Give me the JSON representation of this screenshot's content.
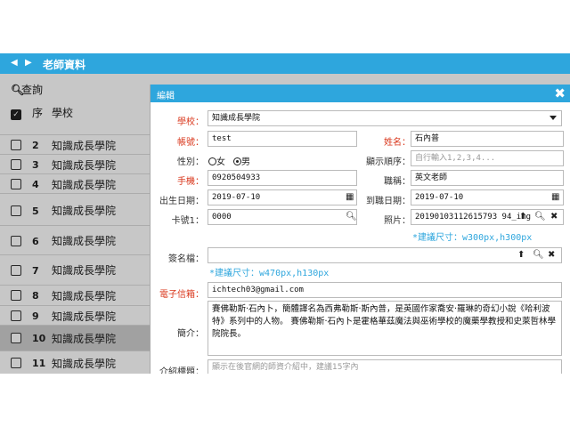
{
  "topbar": {
    "title": "老師資料",
    "prev_icon": "chevron-left-icon",
    "next_icon": "chevron-right-icon"
  },
  "list": {
    "search_label": "查詢",
    "header": {
      "seq": "序",
      "school": "學校"
    },
    "rows": [
      {
        "num": "2",
        "school": "知識成長學院"
      },
      {
        "num": "3",
        "school": "知識成長學院"
      },
      {
        "num": "4",
        "school": "知識成長學院"
      },
      {
        "num": "5",
        "school": "知識成長學院"
      },
      {
        "num": "6",
        "school": "知識成長學院"
      },
      {
        "num": "7",
        "school": "知識成長學院"
      },
      {
        "num": "8",
        "school": "知識成長學院"
      },
      {
        "num": "9",
        "school": "知識成長學院"
      },
      {
        "num": "10",
        "school": "知識成長學院"
      },
      {
        "num": "11",
        "school": "知識成長學院"
      }
    ]
  },
  "modal": {
    "title": "編輯",
    "school": {
      "label": "學校：",
      "value": "知識成長學院"
    },
    "account": {
      "label": "帳號：",
      "value": "test"
    },
    "name": {
      "label": "姓名：",
      "value": "石內普"
    },
    "gender": {
      "label": "性別：",
      "female": "女",
      "male": "男"
    },
    "display_order": {
      "label": "顯示順序：",
      "placeholder": "自行輸入1,2,3,4..."
    },
    "mobile": {
      "label": "手機：",
      "value": "0920504933"
    },
    "position": {
      "label": "職稱：",
      "value": "英文老師"
    },
    "birthday": {
      "label": "出生日期：",
      "value": "2019-07-10"
    },
    "hire_date": {
      "label": "到職日期：",
      "value": "2019-07-10"
    },
    "card_no": {
      "label": "卡號1：",
      "value": "0000"
    },
    "photo": {
      "label": "照片：",
      "value": "20190103112615793 94_img",
      "hint": "*建議尺寸：w300px,h300px"
    },
    "signature": {
      "label": "簽名檔：",
      "value": "",
      "hint": "*建議尺寸：w470px,h130px"
    },
    "email": {
      "label": "電子信箱：",
      "value": "ichtech03@gmail.com"
    },
    "bio": {
      "label": "簡介：",
      "value": "賽佛勒斯·石內卜，簡體譯名為西弗勒斯·斯內普，是英國作家喬安·羅琳的奇幻小說《哈利波特》系列中的人物。 賽佛勒斯·石內卜是霍格華茲魔法與巫術學校的魔藥學教授和史萊哲林學院院長。"
    },
    "intro_title": {
      "label": "介紹標題：",
      "placeholder": "顯示在後官網的師資介紹中，建議15字內"
    }
  }
}
